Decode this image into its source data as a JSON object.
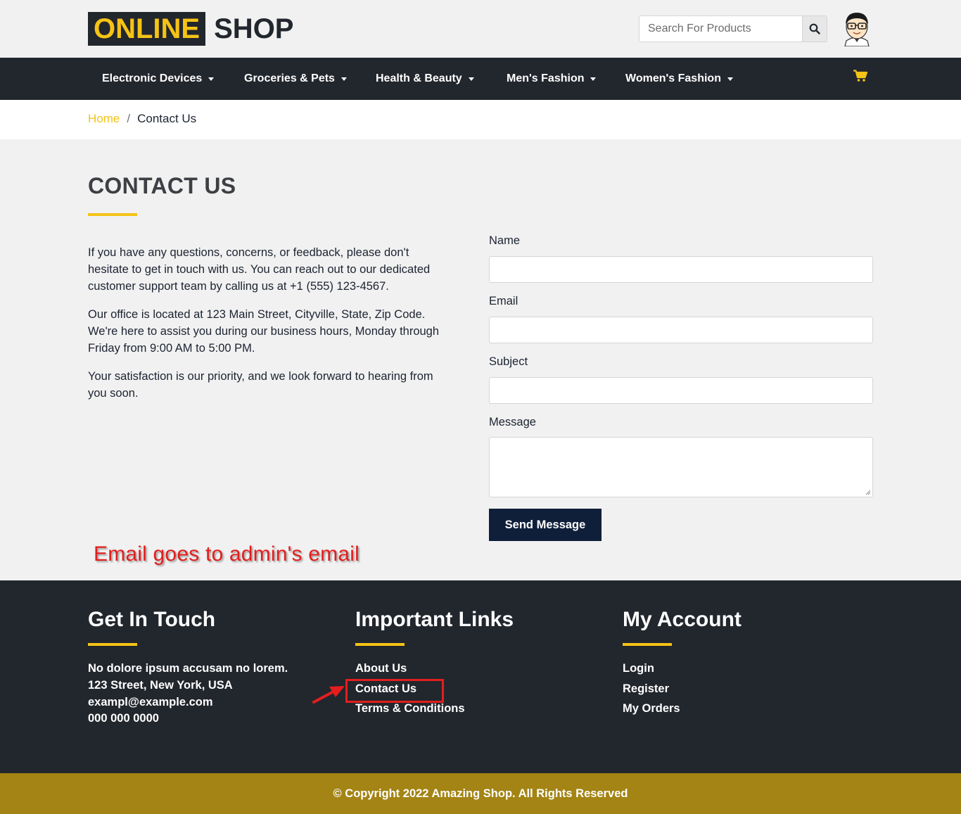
{
  "header": {
    "logo_primary": "ONLINE",
    "logo_secondary": "SHOP",
    "search_placeholder": "Search For Products",
    "search_icon": "search-icon",
    "avatar_icon": "user-avatar-icon"
  },
  "nav": {
    "items": [
      {
        "label": "Electronic Devices"
      },
      {
        "label": "Groceries & Pets"
      },
      {
        "label": "Health & Beauty"
      },
      {
        "label": "Men's Fashion"
      },
      {
        "label": "Women's Fashion"
      }
    ],
    "cart_icon": "shopping-cart-icon"
  },
  "breadcrumb": {
    "home": "Home",
    "separator": "/",
    "current": "Contact Us"
  },
  "main": {
    "title": "CONTACT US",
    "paragraphs": [
      "If you have any questions, concerns, or feedback, please don't hesitate to get in touch with us. You can reach out to our dedicated customer support team by calling us at +1 (555) 123-4567.",
      "Our office is located at 123 Main Street, Cityville, State, Zip Code. We're here to assist you during our business hours, Monday through Friday from 9:00 AM to 5:00 PM.",
      "Your satisfaction is our priority, and we look forward to hearing from you soon."
    ]
  },
  "form": {
    "name_label": "Name",
    "name_value": "",
    "email_label": "Email",
    "email_value": "",
    "subject_label": "Subject",
    "subject_value": "",
    "message_label": "Message",
    "message_value": "",
    "submit_label": "Send Message"
  },
  "annotation": {
    "note": "Email goes to admin's email"
  },
  "footer": {
    "touch": {
      "heading": "Get In Touch",
      "lines": [
        "No dolore ipsum accusam no lorem.",
        "123 Street, New York, USA",
        "exampl@example.com",
        "000 000 0000"
      ]
    },
    "links": {
      "heading": "Important Links",
      "items": [
        "About Us",
        "Contact Us",
        "Terms & Conditions"
      ]
    },
    "account": {
      "heading": "My Account",
      "items": [
        "Login",
        "Register",
        "My Orders"
      ]
    },
    "copyright": "© Copyright 2022 Amazing Shop. All Rights Reserved"
  },
  "colors": {
    "accent": "#f5c316",
    "dark": "#22262d",
    "button": "#0f1f3a",
    "copyright_bg": "#a38414",
    "annotation": "#e31e1e"
  }
}
